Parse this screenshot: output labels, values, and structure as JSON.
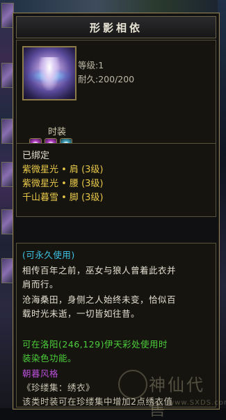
{
  "item": {
    "name": "形影相依",
    "level": "等级:1",
    "durability": "耐久:200/200",
    "category": "时装",
    "gems": [
      "purple-gem",
      "purple-gem",
      "cyan-gem"
    ]
  },
  "binding": {
    "status": "已绑定",
    "set_items": [
      "紫微星光 • 肩 (3级)",
      "紫微星光 • 腰 (3级)",
      "千山暮雪 • 脚 (3级)"
    ]
  },
  "description": {
    "usage": "(可永久使用)",
    "lore": [
      "相传百年之前，巫女与狼人曾着此衣并",
      "肩而行。",
      "沧海桑田，身侧之人始终未变，恰似百",
      "载时光未逝，一切皆如往昔。"
    ],
    "dye_info": [
      "可在洛阳(246,129)伊天彩处使用时",
      "装染色功能。"
    ],
    "style": "朝暮风格",
    "collection": "《珍缕集：绣衣》",
    "collection_bonus": "该类时装可在珍缕集中增加2点绣衣值"
  },
  "watermark": {
    "text": "神仙代售",
    "url": "www.SXDS.com"
  },
  "colors": {
    "set_item": "#e8c84a",
    "usage": "#3fc4e6",
    "dye": "#4ccf3a",
    "style": "#b84fd6"
  }
}
